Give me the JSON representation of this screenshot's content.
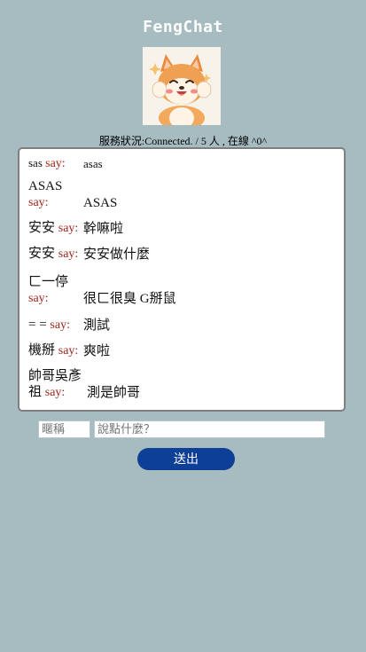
{
  "app": {
    "title": "FengChat"
  },
  "status": {
    "text": "服務狀況:Connected. / 5 人 , 在線 ^0^"
  },
  "messages": [
    {
      "name": "sas",
      "say": "say:",
      "text": "asas"
    },
    {
      "name": "ASAS",
      "say": "say:",
      "text": "ASAS"
    },
    {
      "name": "安安",
      "say": "say:",
      "text": "幹嘛啦"
    },
    {
      "name": "安安",
      "say": "say:",
      "text": "安安做什麼"
    },
    {
      "name": "ㄈ一停",
      "say": "say:",
      "text": "很ㄈ很臭 G掰鼠"
    },
    {
      "name": "= =",
      "say": "say:",
      "text": "測試"
    },
    {
      "name": "機掰",
      "say": "say:",
      "text": "爽啦"
    },
    {
      "name": "帥哥吳彥祖",
      "say": "say:",
      "text": "測是帥哥"
    }
  ],
  "form": {
    "nick_placeholder": "暱稱",
    "message_placeholder": "說點什麼？",
    "send_label": "送出"
  },
  "colors": {
    "background": "#a6bcc1",
    "say_color": "#a0281e",
    "button": "#0d3f96"
  }
}
